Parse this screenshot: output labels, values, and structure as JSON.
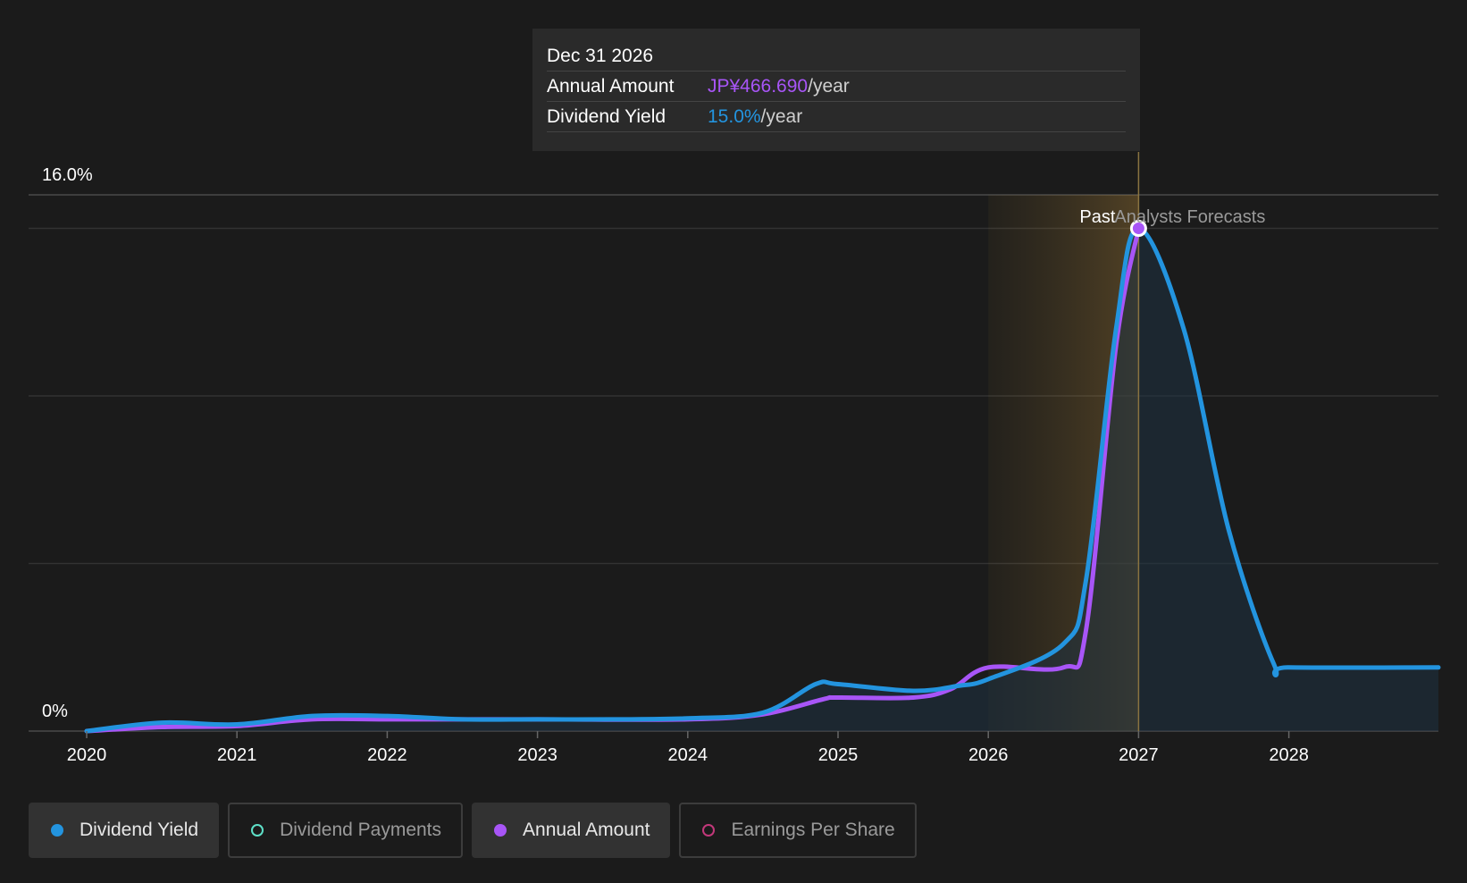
{
  "chart_data": {
    "type": "area",
    "y_axis": {
      "top_label": "16.0%",
      "bottom_label": "0%",
      "min": 0,
      "max": 16
    },
    "x_ticks": [
      "2020",
      "2021",
      "2022",
      "2023",
      "2024",
      "2025",
      "2026",
      "2027",
      "2028"
    ],
    "x_range": [
      2020.0,
      2029.0
    ],
    "past_label": "Past",
    "forecast_label": "Analysts Forecasts",
    "past_region": [
      2026.0,
      2027.0
    ],
    "series": [
      {
        "name": "Dividend Yield",
        "color": "#2394df",
        "points": [
          [
            2020.0,
            0.0
          ],
          [
            2020.5,
            0.25
          ],
          [
            2021.0,
            0.2
          ],
          [
            2021.5,
            0.45
          ],
          [
            2022.0,
            0.45
          ],
          [
            2022.5,
            0.35
          ],
          [
            2023.0,
            0.35
          ],
          [
            2023.5,
            0.35
          ],
          [
            2024.0,
            0.38
          ],
          [
            2024.5,
            0.55
          ],
          [
            2024.85,
            1.4
          ],
          [
            2025.0,
            1.4
          ],
          [
            2025.5,
            1.2
          ],
          [
            2025.8,
            1.35
          ],
          [
            2026.0,
            1.55
          ],
          [
            2026.5,
            2.6
          ],
          [
            2026.65,
            4.5
          ],
          [
            2026.85,
            12.0
          ],
          [
            2027.0,
            15.0
          ],
          [
            2027.3,
            12.0
          ],
          [
            2027.6,
            6.0
          ],
          [
            2027.9,
            2.0
          ],
          [
            2028.0,
            1.9
          ],
          [
            2029.0,
            1.9
          ]
        ]
      },
      {
        "name": "Annual Amount",
        "color": "#a855f7",
        "points": [
          [
            2020.0,
            0.0
          ],
          [
            2020.5,
            0.12
          ],
          [
            2021.0,
            0.15
          ],
          [
            2021.5,
            0.35
          ],
          [
            2022.0,
            0.35
          ],
          [
            2023.0,
            0.35
          ],
          [
            2024.0,
            0.35
          ],
          [
            2024.5,
            0.5
          ],
          [
            2024.9,
            0.95
          ],
          [
            2025.0,
            1.0
          ],
          [
            2025.5,
            1.0
          ],
          [
            2025.75,
            1.25
          ],
          [
            2026.0,
            1.9
          ],
          [
            2026.5,
            1.9
          ],
          [
            2026.65,
            3.0
          ],
          [
            2026.85,
            11.5
          ],
          [
            2027.0,
            15.0
          ]
        ]
      }
    ],
    "highlight": {
      "x": 2027.0,
      "y": 15.0
    },
    "tooltip": {
      "date": "Dec 31 2026",
      "rows": [
        {
          "label": "Annual Amount",
          "value": "JP¥466.690",
          "unit": "/year",
          "color": "#a855f7"
        },
        {
          "label": "Dividend Yield",
          "value": "15.0%",
          "unit": "/year",
          "color": "#2394df"
        }
      ]
    }
  },
  "legend": [
    {
      "label": "Dividend Yield",
      "color": "#2394df",
      "active": true,
      "filled": true
    },
    {
      "label": "Dividend Payments",
      "color": "#5ee0c8",
      "active": false,
      "filled": false
    },
    {
      "label": "Annual Amount",
      "color": "#a855f7",
      "active": true,
      "filled": true
    },
    {
      "label": "Earnings Per Share",
      "color": "#c2387a",
      "active": false,
      "filled": false
    }
  ]
}
